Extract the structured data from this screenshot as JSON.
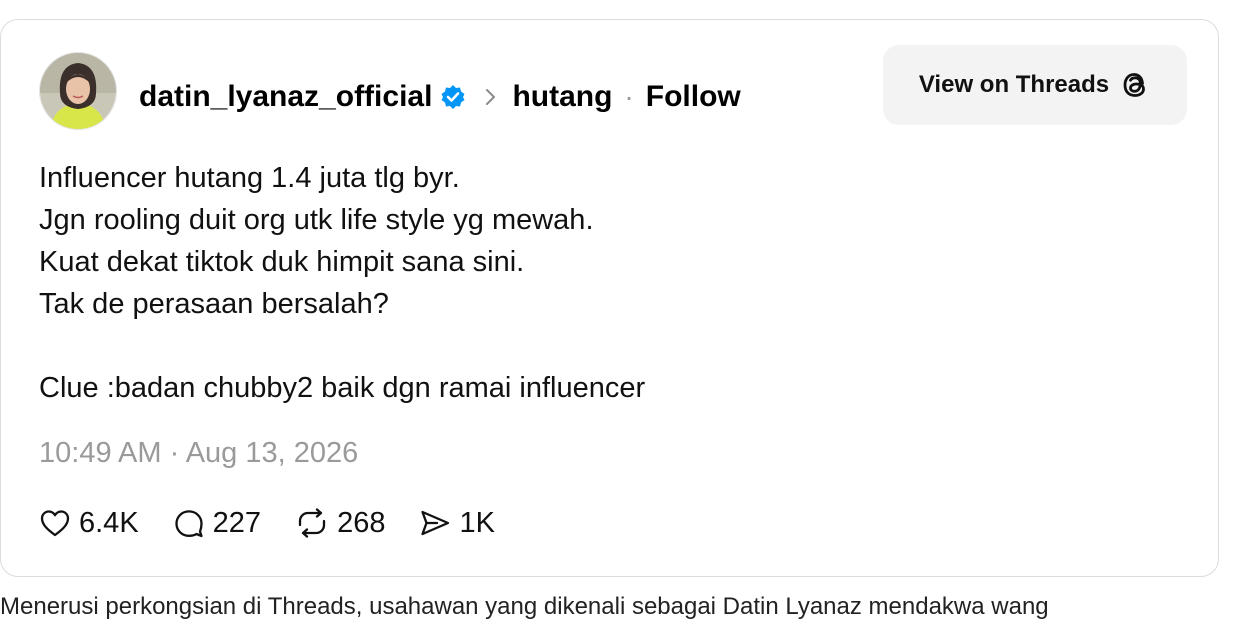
{
  "post": {
    "username": "datin_lyanaz_official",
    "topic": "hutang",
    "separator": "·",
    "follow_label": "Follow",
    "view_button_label": "View on Threads",
    "text_lines": [
      "Influencer hutang 1.4 juta tlg byr.",
      "Jgn rooling duit org utk life style yg mewah.",
      "Kuat dekat tiktok duk himpit sana sini.",
      "Tak de perasaan bersalah?",
      "",
      "Clue :badan chubby2 baik dgn ramai influencer"
    ],
    "timestamp": "10:49 AM · Aug 13, 2026",
    "stats": {
      "likes": "6.4K",
      "replies": "227",
      "reposts": "268",
      "shares": "1K"
    }
  },
  "caption": "Menerusi perkongsian di Threads, usahawan yang dikenali sebagai Datin Lyanaz mendakwa wang",
  "icons": {
    "verified": "verified-badge-icon",
    "chevron": "chevron-right-icon",
    "threads": "threads-logo-icon",
    "like": "heart-icon",
    "reply": "comment-icon",
    "repost": "repost-icon",
    "share": "share-icon"
  },
  "colors": {
    "verified_blue": "#0095f6",
    "muted_gray": "#9a9a9a",
    "button_bg": "#f3f3f3",
    "avatar_bg": "#d8e64a"
  }
}
